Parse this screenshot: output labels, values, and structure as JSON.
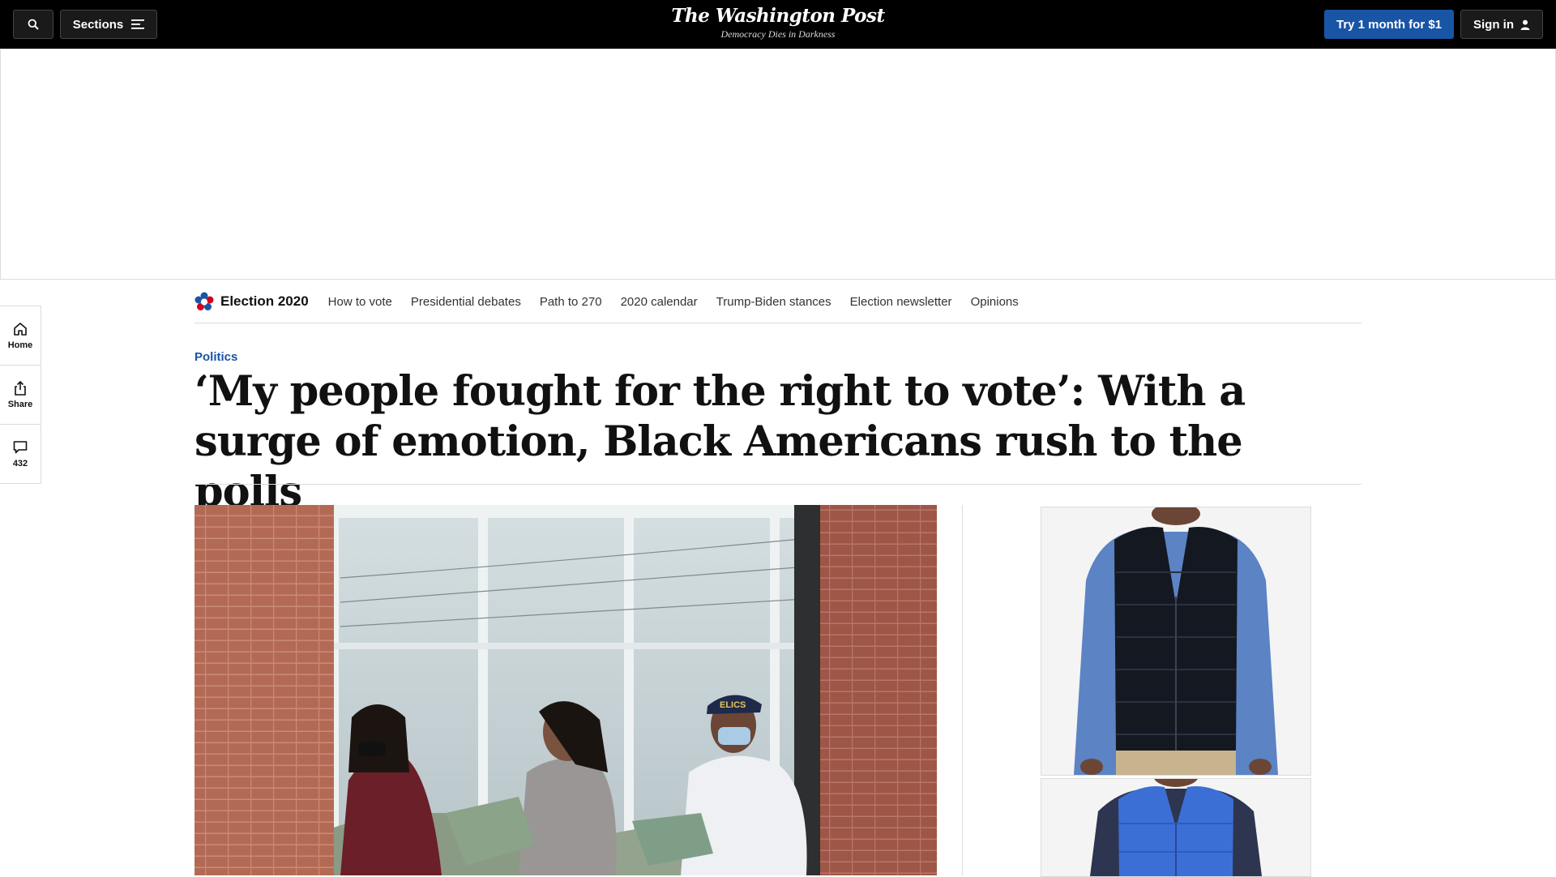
{
  "topbar": {
    "sections_label": "Sections",
    "logo": "The Washington Post",
    "tagline": "Democracy Dies in Darkness",
    "try_label": "Try 1 month for $1",
    "signin_label": "Sign in"
  },
  "rail": {
    "home_label": "Home",
    "share_label": "Share",
    "comments_count": "432"
  },
  "election_nav": {
    "title": "Election 2020",
    "links": [
      "How to vote",
      "Presidential debates",
      "Path to 270",
      "2020 calendar",
      "Trump-Biden stances",
      "Election newsletter",
      "Opinions"
    ]
  },
  "article": {
    "kicker": "Politics",
    "headline": "‘My people fought for the right to vote’: With a surge of emotion, Black Americans rush to the polls"
  },
  "colors": {
    "brand_blue": "#1955a5",
    "topbar_bg": "#000000",
    "rule": "#dcdcdc"
  },
  "icons": [
    "search-icon",
    "menu-icon",
    "user-icon",
    "home-icon",
    "share-icon",
    "comment-icon",
    "election-star-icon",
    "adchoices-icon",
    "close-icon"
  ]
}
